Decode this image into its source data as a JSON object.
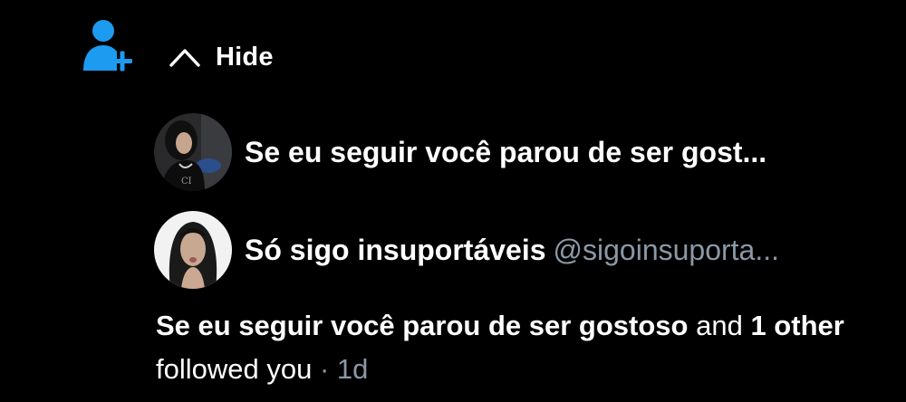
{
  "notification": {
    "icon": "person-add-icon",
    "accent_color": "#1d9bf0",
    "hide_label": "Hide",
    "followers": [
      {
        "name": "Se eu seguir você parou de ser gost...",
        "handle": "",
        "avatar": "avatar-photo"
      },
      {
        "name": "Só sigo insuportáveis",
        "handle": "@sigoinsuporta...",
        "avatar": "avatar-photo"
      }
    ],
    "summary": {
      "first_name": "Se eu seguir você parou de ser gostoso",
      "conjunction": "and",
      "others": "1 other",
      "action": "followed you",
      "separator": "·",
      "time": "1d"
    }
  }
}
